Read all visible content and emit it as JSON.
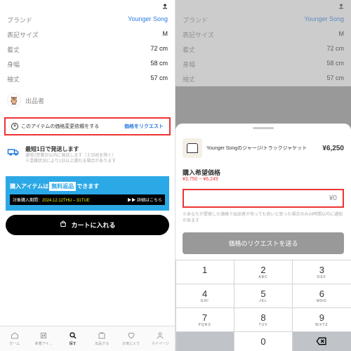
{
  "left": {
    "brand_lbl": "ブランド",
    "brand": "Younger Song",
    "size_lbl": "表記サイズ",
    "size": "M",
    "l1_lbl": "着丈",
    "l1": "72 cm",
    "l2_lbl": "身幅",
    "l2": "58 cm",
    "l3_lbl": "袖丈",
    "l3": "57 cm",
    "seller": "出品者",
    "price_req_text": "このアイテムの価格変更依頼をする",
    "price_req_link": "価格をリクエスト",
    "ship_title": "最短1日で発送します",
    "ship_sub1": "通常2営業日以内に発送します（土日祝を除く）",
    "ship_sub2": "※混雑状況により1日以上遅れる場合があります",
    "banner_main_1": "購入アイテムは",
    "banner_main_2": "無料返品",
    "banner_main_3": "できます",
    "banner_period_lbl": "対象購入期間：",
    "banner_period": "2024.12.12THU – 31TUE",
    "banner_more": "▶▶ 詳細はこちら",
    "cart": "カートに入れる",
    "tabs": [
      "ホーム",
      "新着アイ…",
      "探す",
      "出品する",
      "お気に入り",
      "マイページ"
    ]
  },
  "right": {
    "prod_name": "Younger Songのジャージ/トラックジャケット",
    "prod_price": "¥6,250",
    "wish_lbl": "購入希望価格",
    "wish_range": "¥3,750 ~ ¥6,249",
    "wish_val": "¥0",
    "wish_note": "※あなたが提案した価格で出品者が売っても良いと思った場合のみ24時間以内に通知が来ます",
    "send": "価格のリクエストを送る",
    "keys": [
      [
        "1",
        ""
      ],
      [
        "2",
        "ABC"
      ],
      [
        "3",
        "DEF"
      ],
      [
        "4",
        "GHI"
      ],
      [
        "5",
        "JKL"
      ],
      [
        "6",
        "MNO"
      ],
      [
        "7",
        "PQRS"
      ],
      [
        "8",
        "TUV"
      ],
      [
        "9",
        "WXYZ"
      ],
      [
        "",
        ""
      ],
      [
        "0",
        ""
      ],
      [
        "⌫",
        ""
      ]
    ]
  }
}
